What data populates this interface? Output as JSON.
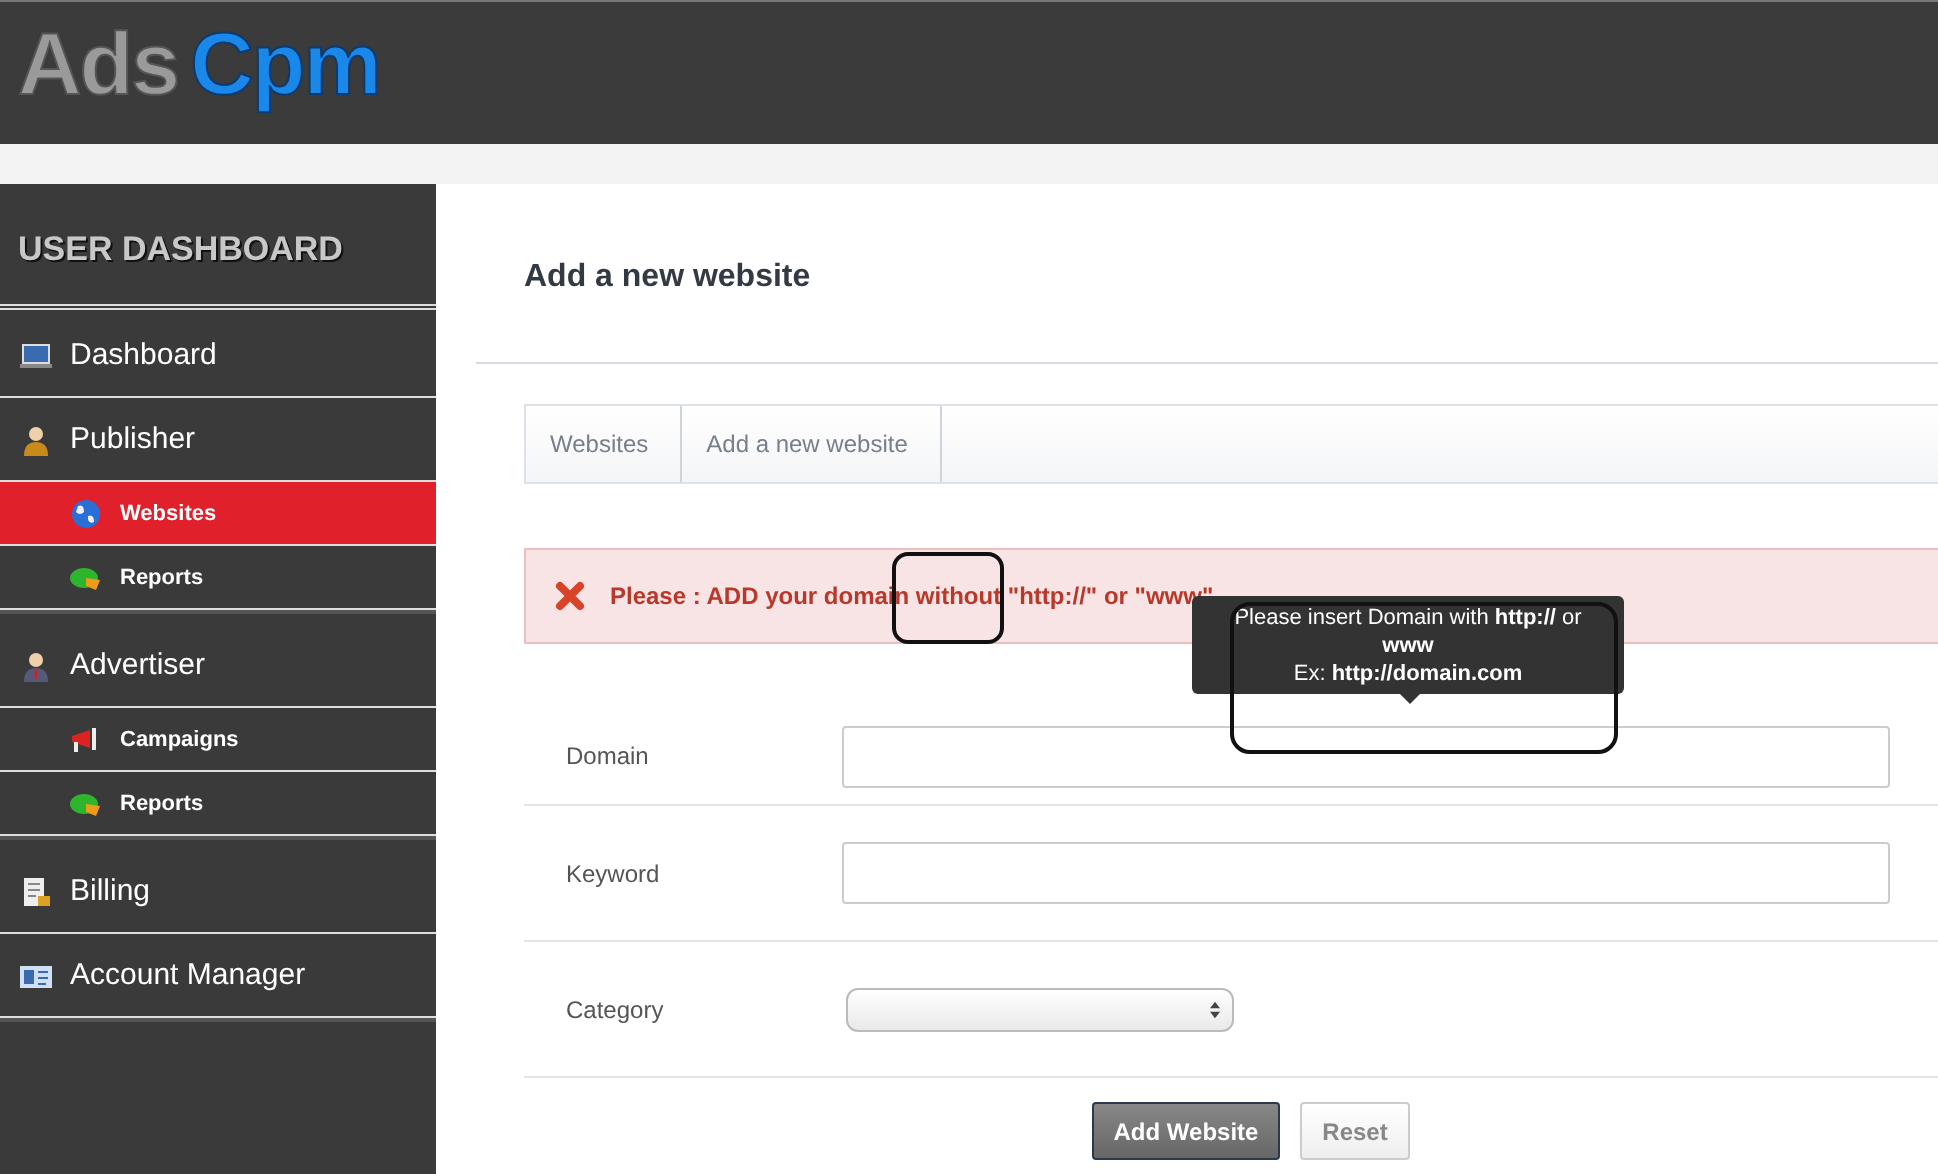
{
  "header": {
    "logo": [
      "Ads",
      "Cpm"
    ]
  },
  "sidebar": {
    "title": "USER DASHBOARD",
    "groups": [
      {
        "items": [
          {
            "label": "Dashboard",
            "kind": "main",
            "selected": false
          },
          {
            "label": "Publisher",
            "kind": "main",
            "selected": false
          },
          {
            "label": "Websites",
            "kind": "sub",
            "selected": true
          },
          {
            "label": "Reports",
            "kind": "sub",
            "selected": false
          }
        ]
      },
      {
        "items": [
          {
            "label": "Advertiser",
            "kind": "main",
            "selected": false
          },
          {
            "label": "Campaigns",
            "kind": "sub",
            "selected": false
          },
          {
            "label": "Reports",
            "kind": "sub",
            "selected": false
          }
        ]
      },
      {
        "items": [
          {
            "label": "Billing",
            "kind": "main",
            "selected": false
          },
          {
            "label": "Account Manager",
            "kind": "main",
            "selected": false
          }
        ]
      }
    ]
  },
  "page": {
    "title": "Add a new website"
  },
  "breadcrumb": [
    "Websites",
    "Add a new website"
  ],
  "alert": {
    "text": "Please : ADD your domain without \"http://\" or \"www\""
  },
  "tooltip": {
    "lines": [
      "Please insert Domain with **http://** or **www**",
      "Ex: **http://domain.com**"
    ]
  },
  "form": {
    "fields": [
      {
        "label": "Domain",
        "kind": "text"
      },
      {
        "label": "Keyword",
        "kind": "text"
      },
      {
        "label": "Category",
        "kind": "select"
      }
    ],
    "buttons": [
      {
        "label": "Add Website",
        "kind": "primary"
      },
      {
        "label": "Reset",
        "kind": "secondary"
      }
    ]
  }
}
